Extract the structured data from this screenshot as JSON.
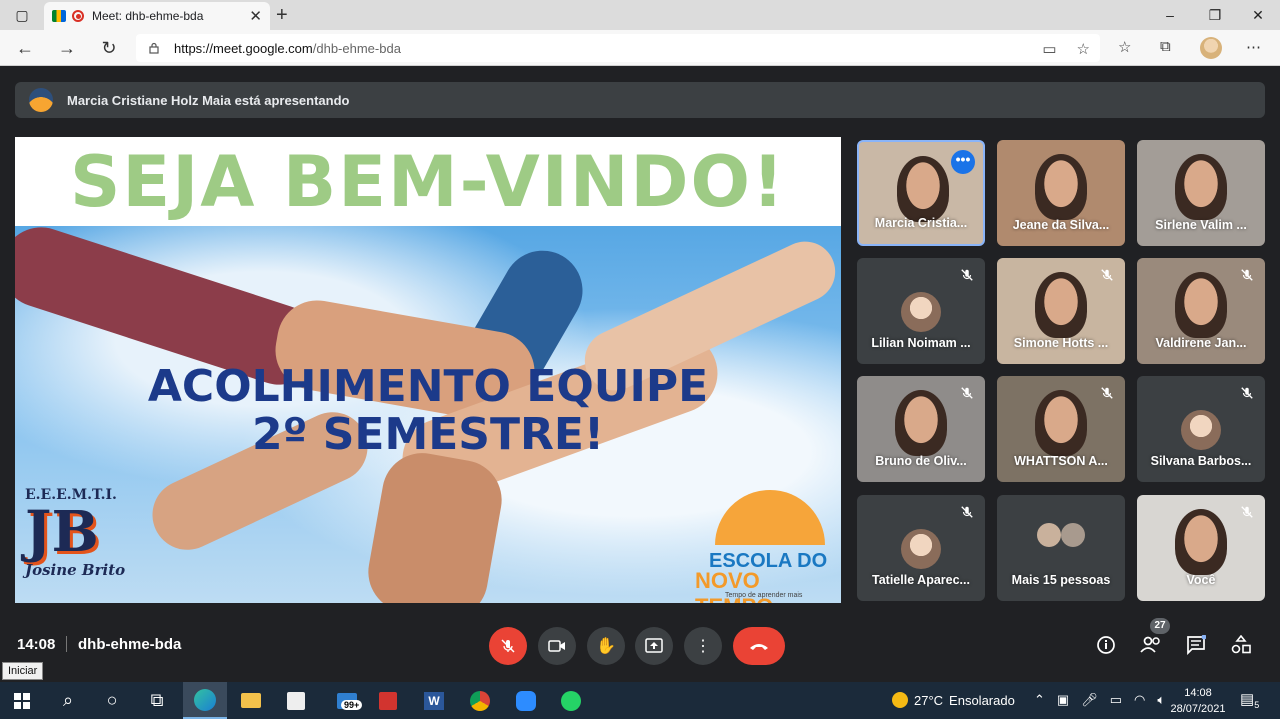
{
  "browser": {
    "tab_title": "Meet: dhb-ehme-bda",
    "new_tab": "+",
    "url_host": "https://meet.google.com",
    "url_path": "/dhb-ehme-bda",
    "window_controls": [
      "minimize-icon",
      "restore-icon",
      "close-icon"
    ]
  },
  "meet": {
    "presenting_text": "Marcia Cristiane Holz Maia está apresentando",
    "slide": {
      "banner": "SEJA BEM-VINDO!",
      "headline_line1": "ACOLHIMENTO EQUIPE",
      "headline_line2": "2º SEMESTRE!",
      "logo_left_top": "E.E.E.M.T.I.",
      "logo_left_mark": "JB",
      "logo_left_name": "Josine Brito",
      "logo_right_line1": "ESCOLA DO",
      "logo_right_line2": "NOVO TEMPO",
      "logo_right_tagline": "Tempo de aprender mais"
    },
    "participants": [
      {
        "name": "Marcia Cristia...",
        "muted": false,
        "active": true,
        "bg": "#c9b8a6"
      },
      {
        "name": "Jeane da Silva...",
        "muted": false,
        "active": false,
        "bg": "#b08a6e"
      },
      {
        "name": "Sirlene Valim ...",
        "muted": false,
        "active": false,
        "bg": "#a39d97"
      },
      {
        "name": "Lilian Noimam ...",
        "muted": true,
        "active": false,
        "bg": "#3c4043"
      },
      {
        "name": "Simone Hotts ...",
        "muted": true,
        "active": false,
        "bg": "#c8b5a0"
      },
      {
        "name": "Valdirene Jan...",
        "muted": true,
        "active": false,
        "bg": "#9a8a7c"
      },
      {
        "name": "Bruno de Oliv...",
        "muted": true,
        "active": false,
        "bg": "#8f8c8a"
      },
      {
        "name": "WHATTSON A...",
        "muted": true,
        "active": false,
        "bg": "#7d7264"
      },
      {
        "name": "Silvana Barbos...",
        "muted": true,
        "active": false,
        "bg": "#3c4043"
      },
      {
        "name": "Tatielle Aparec...",
        "muted": true,
        "active": false,
        "bg": "#3c4043"
      },
      {
        "name": "Mais 15 pessoas",
        "muted": false,
        "active": false,
        "bg": "#3c4043"
      },
      {
        "name": "Você",
        "muted": true,
        "active": false,
        "bg": "#d8d6d2"
      }
    ],
    "clock": "14:08",
    "meeting_code": "dhb-ehme-bda",
    "participant_count": "27",
    "tooltip": "Iniciar"
  },
  "taskbar": {
    "weather_temp": "27°C",
    "weather_text": "Ensolarado",
    "mail_badge": "99+",
    "time": "14:08",
    "date": "28/07/2021",
    "notifications": "5"
  },
  "colors": {
    "meet_bg": "#202124",
    "tile_bg": "#3c4043",
    "red": "#ea4335",
    "accent_blue": "#8ab4f8",
    "banner_green": "#9ecb85",
    "headline_blue": "#1c3a8a"
  }
}
